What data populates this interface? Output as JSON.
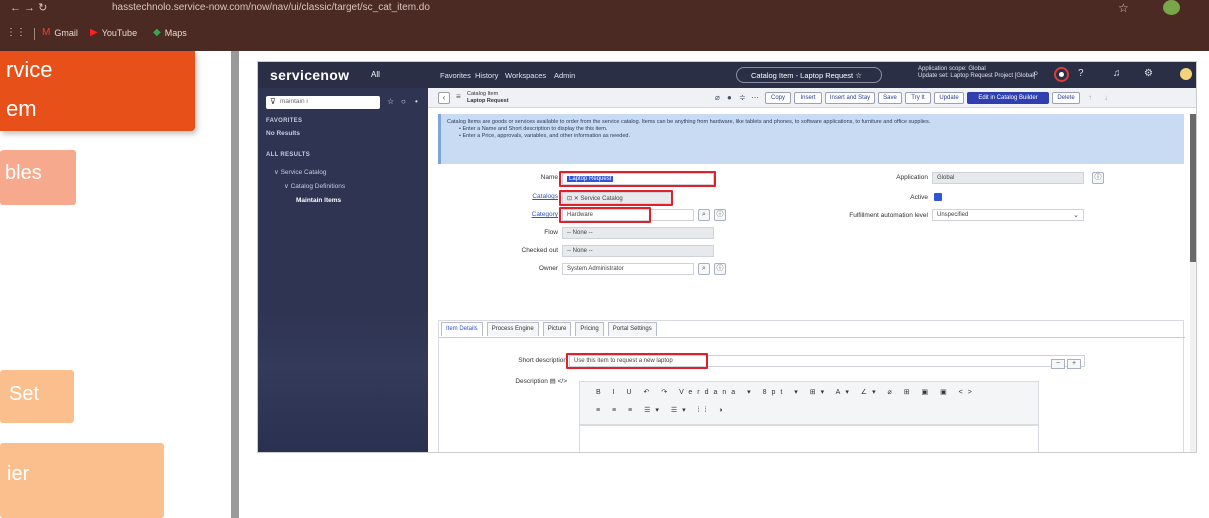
{
  "browser": {
    "url": "hasstechnolo.service-now.com/now/nav/ui/classic/target/sc_cat_item.do",
    "bookmarks": [
      {
        "label": "Gmail",
        "icon": "gmail-icon"
      },
      {
        "label": "YouTube",
        "icon": "youtube-icon"
      },
      {
        "label": "Maps",
        "icon": "maps-icon"
      }
    ]
  },
  "slide": {
    "main_line1": "rvice",
    "main_line2": "em",
    "roles": "bles",
    "set": "Set",
    "er": "ier",
    "colors": {
      "orange": "#e8501a",
      "peach": "#f6a98c",
      "light_peach": "#fbbf8e"
    }
  },
  "sn": {
    "logo": "servicenow",
    "all": "All",
    "nav": [
      "Favorites",
      "History",
      "Workspaces",
      "Admin"
    ],
    "record_pill": "Catalog Item - Laptop Request ☆",
    "scope_line1": "Application scope: Global",
    "scope_line2": "Update set: Laptop Request Project [Global]",
    "filter_value": "maintain i",
    "sidebar": {
      "favorites_header": "FAVORITES",
      "favorites_empty": "No Results",
      "all_results_header": "ALL RESULTS",
      "item1": "Service Catalog",
      "item2": "Catalog Definitions",
      "item3": "Maintain Items"
    },
    "toolbar": {
      "title_line1": "Catalog Item",
      "title_line2": "Laptop Request",
      "buttons": [
        "Copy",
        "Insert",
        "Insert and Stay",
        "Save",
        "Try It",
        "Update",
        "Edit in Catalog Builder",
        "Delete"
      ]
    },
    "info": {
      "line1": "Catalog Items are goods or services available to order from the service catalog. Items can be anything from hardware, like tablets and phones, to software applications, to furniture and office supplies.",
      "line2": "• Enter a Name and Short description to display the this item.",
      "line3": "• Enter a Price, approvals, variables, and other information as needed."
    },
    "form": {
      "name_label": "Name",
      "name_value": "Laptop Request",
      "catalogs_label": "Catalogs",
      "catalogs_value": "Service Catalog",
      "category_label": "Category",
      "category_value": "Hardware",
      "flow_label": "Flow",
      "flow_value": "-- None --",
      "checkout_label": "Checked out",
      "checkout_value": "-- None --",
      "owner_label": "Owner",
      "owner_value": "System Administrator",
      "application_label": "Application",
      "application_value": "Global",
      "active_label": "Active",
      "fulfillment_label": "Fulfillment automation level",
      "fulfillment_value": "Unspecified"
    },
    "tabs": [
      "Item Details",
      "Process Engine",
      "Picture",
      "Pricing",
      "Portal Settings"
    ],
    "details": {
      "short_desc_label": "Short description",
      "short_desc_value": "Use this item to request a new laptop",
      "description_label": "Description",
      "editor_row1": "B I U ↶ ↷ Verdana ▾ 8pt ▾ ⊞▾ A▾ ∠▾ ⌀ ⊞ ▣ ▣ <>",
      "editor_row2": "≡ ≡ ≡ ☰▾ ☰▾ ⁞⁞ ◑"
    }
  }
}
